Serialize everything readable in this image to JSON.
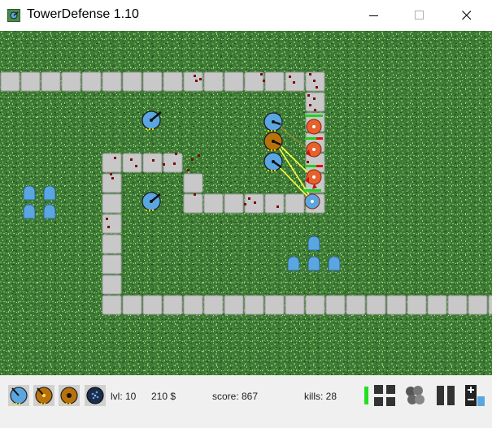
{
  "window": {
    "title": "TowerDefense 1.10",
    "controls": [
      "minimize",
      "maximize",
      "close"
    ]
  },
  "colors": {
    "grass": "#3e7a35",
    "path": "#c8c8c8",
    "path_border": "#9a9a9a",
    "blood": "#7a0a0a",
    "enemy_orange": "#e8602c",
    "tower_blue": "#5aa6e0",
    "tower_brown": "#b8720c",
    "laser": "#ffff40",
    "health_green": "#20d020",
    "health_red": "#e01010",
    "toolbar_bg": "#f0f0f0"
  },
  "toolbar": {
    "tower_buttons": [
      {
        "name": "basic-tower",
        "icon": "blue-cannon-tower-icon"
      },
      {
        "name": "laser-tower",
        "icon": "brown-laser-tower-icon"
      },
      {
        "name": "heavy-tower",
        "icon": "brown-heavy-tower-icon"
      },
      {
        "name": "splash-tower",
        "icon": "dark-splash-tower-icon"
      }
    ],
    "level": "lvl: 10",
    "money": "210 $",
    "score": "score: 867",
    "kills": "kills: 28",
    "controls": [
      {
        "name": "health-indicator",
        "icon": "green-bar-icon"
      },
      {
        "name": "grid-toggle",
        "icon": "grid-icon"
      },
      {
        "name": "smoke-toggle",
        "icon": "smoke-icon"
      },
      {
        "name": "pause",
        "icon": "pause-icon"
      },
      {
        "name": "speed",
        "icon": "plus-minus-icon"
      }
    ]
  }
}
